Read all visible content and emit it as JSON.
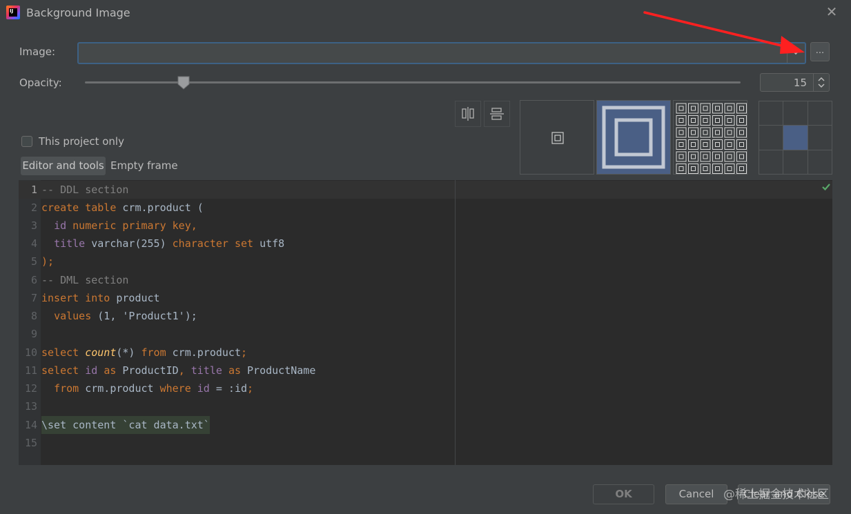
{
  "window": {
    "title": "Background Image",
    "app_icon_text": "IJ"
  },
  "image": {
    "label": "Image:",
    "value": "",
    "browse_label": "..."
  },
  "opacity": {
    "label": "Opacity:",
    "value": "15",
    "slider_value": 15,
    "slider_max": 100
  },
  "this_project_only": {
    "label": "This project only",
    "checked": false
  },
  "tabs": [
    {
      "label": "Editor and tools",
      "selected": true
    },
    {
      "label": "Empty frame",
      "selected": false
    }
  ],
  "fill_modes": [
    "center",
    "scale",
    "tile"
  ],
  "anchor": {
    "selected": "center"
  },
  "code_lines": [
    {
      "n": "1",
      "text": "-- DDL section"
    },
    {
      "n": "2",
      "text": "create table crm.product ("
    },
    {
      "n": "3",
      "text": "  id numeric primary key,"
    },
    {
      "n": "4",
      "text": "  title varchar(255) character set utf8"
    },
    {
      "n": "5",
      "text": ");"
    },
    {
      "n": "6",
      "text": "-- DML section"
    },
    {
      "n": "7",
      "text": "insert into product"
    },
    {
      "n": "8",
      "text": "  values (1, 'Product1');"
    },
    {
      "n": "9",
      "text": ""
    },
    {
      "n": "10",
      "text": "select count(*) from crm.product;"
    },
    {
      "n": "11",
      "text": "select id as ProductID, title as ProductName"
    },
    {
      "n": "12",
      "text": "  from crm.product where id = :id;"
    },
    {
      "n": "13",
      "text": ""
    },
    {
      "n": "14",
      "text": "\\set content `cat data.txt`"
    },
    {
      "n": "15",
      "text": ""
    }
  ],
  "buttons": {
    "ok": "OK",
    "cancel": "Cancel",
    "clear_and_close": "Clear and Close"
  },
  "watermark": "@稀土掘金技术社区",
  "colors": {
    "background": "#3c3f41",
    "editor_bg": "#2b2b2b",
    "accent": "#3d6185",
    "keyword": "#cc7832",
    "annotation_arrow": "#ff2020"
  }
}
